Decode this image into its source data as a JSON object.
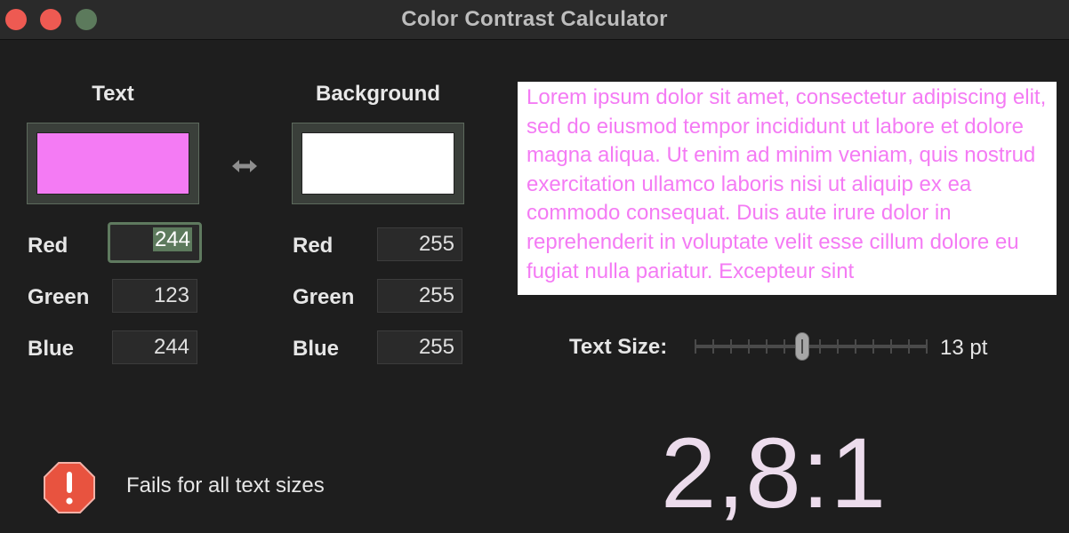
{
  "window": {
    "title": "Color Contrast Calculator"
  },
  "text_color": {
    "heading": "Text",
    "swatch_color": "#f47bf4",
    "red_label": "Red",
    "red": "244",
    "green_label": "Green",
    "green": "123",
    "blue_label": "Blue",
    "blue": "244"
  },
  "background_color": {
    "heading": "Background",
    "swatch_color": "#ffffff",
    "red_label": "Red",
    "red": "255",
    "green_label": "Green",
    "green": "255",
    "blue_label": "Blue",
    "blue": "255"
  },
  "preview": {
    "text": "Lorem ipsum dolor sit amet, consectetur adipiscing elit, sed do eiusmod tempor incididunt ut labore et dolore magna aliqua. Ut enim ad minim veniam, quis nostrud exercitation ullamco laboris nisi ut aliquip ex ea commodo consequat. Duis aute irure dolor in reprehenderit in voluptate velit esse cillum dolore eu fugiat nulla pariatur. Excepteur sint"
  },
  "text_size": {
    "label": "Text Size:",
    "value": "13 pt",
    "slider_fraction": 0.46,
    "tick_count": 14
  },
  "result": {
    "ratio": "2,8:1",
    "status": "Fails for all text sizes",
    "status_icon": "exclamation-octagon-icon",
    "status_color": "#e8533f"
  }
}
